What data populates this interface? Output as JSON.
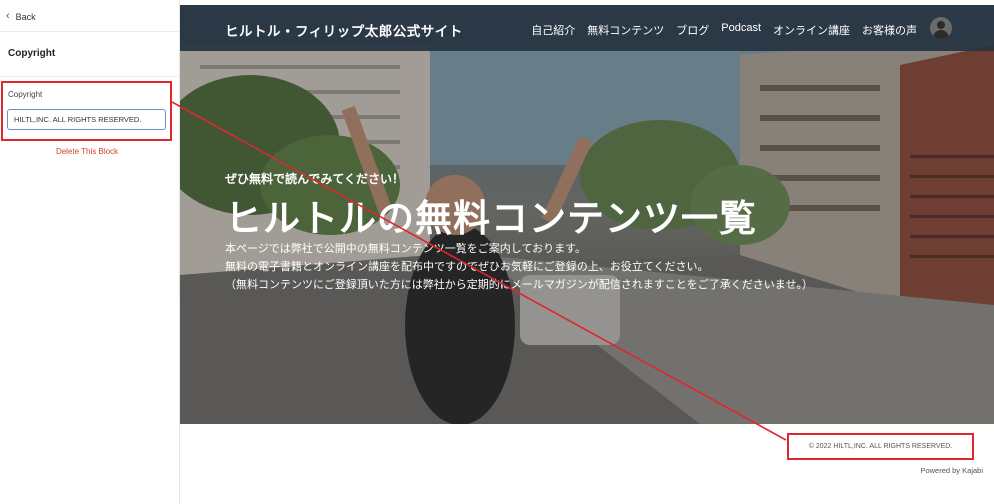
{
  "sidebar": {
    "back_label": "Back",
    "title": "Copyright",
    "field_label": "Copyright",
    "field_value": "HILTL,INC. ALL RIGHTS RESERVED.",
    "delete_label": "Delete This Block"
  },
  "site": {
    "title": "ヒルトル・フィリップ太郎公式サイト",
    "nav": [
      "自己紹介",
      "無料コンテンツ",
      "ブログ",
      "Podcast",
      "オンライン講座",
      "お客様の声"
    ]
  },
  "hero": {
    "eyebrow": "ぜひ無料で読んでみてください！",
    "title": "ヒルトルの無料コンテンツ一覧",
    "desc_lines": [
      "本ページでは弊社で公開中の無料コンテンツ一覧をご案内しております。",
      "無料の電子書籍とオンライン講座を配布中ですのでぜひお気軽にご登録の上、お役立てください。",
      "（無料コンテンツにご登録頂いた方には弊社から定期的にメールマガジンが配信されますことをご了承くださいませ。）"
    ]
  },
  "footer": {
    "copyright": "© 2022 HILTL,INC. ALL RIGHTS RESERVED.",
    "powered": "Powered by Kajabi"
  },
  "colors": {
    "highlight": "#e0262e",
    "navbar": "#263341",
    "delete_link": "#d0442d",
    "input_border": "#6f8fc9"
  },
  "icons": {
    "back": "chevron-left-icon",
    "collapse": "collapse-arrow-icon",
    "avatar": "user-avatar"
  }
}
